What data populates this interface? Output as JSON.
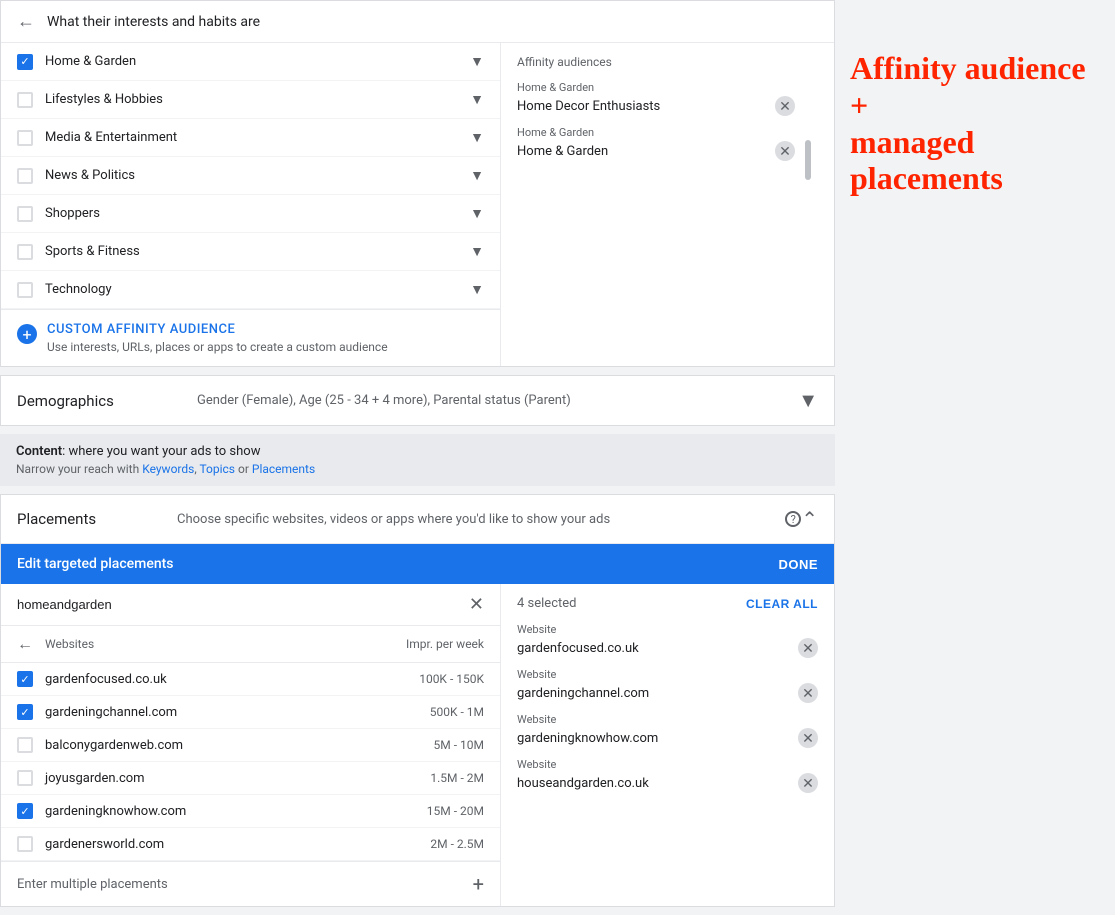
{
  "affinity": {
    "header": "What their interests and habits are",
    "selected_panel_title": "Affinity audiences",
    "items": [
      {
        "label": "Home & Garden",
        "checked": true
      },
      {
        "label": "Lifestyles & Hobbies",
        "checked": false
      },
      {
        "label": "Media & Entertainment",
        "checked": false
      },
      {
        "label": "News & Politics",
        "checked": false
      },
      {
        "label": "Shoppers",
        "checked": false
      },
      {
        "label": "Sports & Fitness",
        "checked": false
      },
      {
        "label": "Technology",
        "checked": false
      }
    ],
    "custom_affinity_title": "CUSTOM AFFINITY AUDIENCE",
    "custom_affinity_desc": "Use interests, URLs, places or apps to create a custom audience",
    "selected_items": [
      {
        "category": "Home & Garden",
        "name": "Home Decor Enthusiasts"
      },
      {
        "category": "Home & Garden",
        "name": "Home & Garden"
      }
    ]
  },
  "demographics": {
    "label": "Demographics",
    "value": "Gender (Female), Age (25 - 34 + 4 more), Parental status (Parent)"
  },
  "content": {
    "title_strong": "Content",
    "title_rest": ": where you want your ads to show",
    "subtitle_plain": "Narrow your reach with ",
    "subtitle_links": [
      "Keywords",
      "Topics",
      "Placements"
    ]
  },
  "placements": {
    "label": "Placements",
    "description": "Choose specific websites, videos or apps where you'd like to show your ads",
    "edit_title": "Edit targeted placements",
    "done_label": "DONE",
    "search_value": "homeandgarden",
    "results_label": "Websites",
    "impr_label": "Impr. per week",
    "websites": [
      {
        "name": "gardenfocused.co.uk",
        "impr": "100K - 150K",
        "checked": true
      },
      {
        "name": "gardeningchannel.com",
        "impr": "500K - 1M",
        "checked": true
      },
      {
        "name": "balconygardenweb.com",
        "impr": "5M - 10M",
        "checked": false
      },
      {
        "name": "joyusgarden.com",
        "impr": "1.5M - 2M",
        "checked": false
      },
      {
        "name": "gardeningknowhow.com",
        "impr": "15M - 20M",
        "checked": true
      },
      {
        "name": "gardenersworld.com",
        "impr": "2M - 2.5M",
        "checked": false
      }
    ],
    "enter_multiple_label": "Enter multiple placements",
    "selected_count": "4 selected",
    "clear_all_label": "CLEAR ALL",
    "selected_placements": [
      {
        "category": "Website",
        "name": "gardenfocused.co.uk"
      },
      {
        "category": "Website",
        "name": "gardeningchannel.com"
      },
      {
        "category": "Website",
        "name": "gardeningknowhow.com"
      },
      {
        "category": "Website",
        "name": "houseandgarden.co.uk"
      }
    ]
  },
  "annotation": {
    "line1": "Affinity audience +",
    "line2": "managed placements"
  }
}
